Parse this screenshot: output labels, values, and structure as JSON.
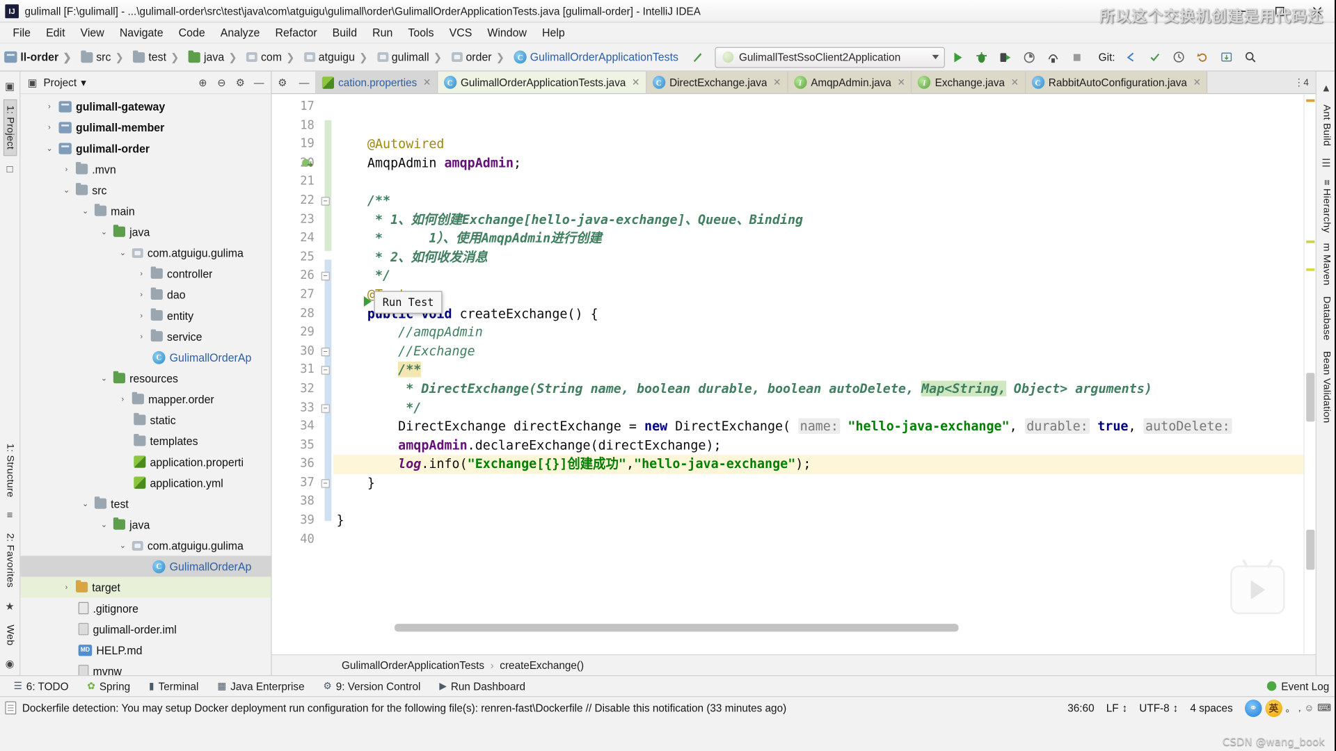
{
  "window": {
    "title": "gulimall [F:\\gulimall] - ...\\gulimall-order\\src\\test\\java\\com\\atguigu\\gulimall\\order\\GulimallOrderApplicationTests.java [gulimall-order] - IntelliJ IDEA",
    "logo_text": "IJ",
    "minimize": "—",
    "maximize": "□",
    "close": "✕"
  },
  "menubar": {
    "items": [
      {
        "label": "File"
      },
      {
        "label": "Edit"
      },
      {
        "label": "View"
      },
      {
        "label": "Navigate"
      },
      {
        "label": "Code"
      },
      {
        "label": "Analyze"
      },
      {
        "label": "Refactor"
      },
      {
        "label": "Build"
      },
      {
        "label": "Run"
      },
      {
        "label": "Tools"
      },
      {
        "label": "VCS"
      },
      {
        "label": "Window"
      },
      {
        "label": "Help"
      }
    ]
  },
  "navbar": {
    "crumbs": [
      {
        "label": "ll-order",
        "icon": "module-icon",
        "bold": true
      },
      {
        "label": "src",
        "icon": "folder-icon"
      },
      {
        "label": "test",
        "icon": "folder-icon"
      },
      {
        "label": "java",
        "icon": "folder-green-icon"
      },
      {
        "label": "com",
        "icon": "package-icon"
      },
      {
        "label": "atguigu",
        "icon": "package-icon"
      },
      {
        "label": "gulimall",
        "icon": "package-icon"
      },
      {
        "label": "order",
        "icon": "package-icon"
      },
      {
        "label": "GulimallOrderApplicationTests",
        "icon": "class-icon",
        "active": true
      }
    ],
    "run_config": {
      "label": "GulimallTestSsoClient2Application",
      "icon": "spring-boot-icon"
    },
    "buttons": [
      {
        "name": "run-button",
        "glyph": "▶"
      },
      {
        "name": "debug-button",
        "glyph": "🐞"
      },
      {
        "name": "run-with-coverage-button",
        "glyph": "▶"
      },
      {
        "name": "profile-button",
        "glyph": "◔"
      },
      {
        "name": "attach-button",
        "glyph": "☰"
      },
      {
        "name": "stop-button",
        "glyph": "■"
      }
    ],
    "git_label": "Git:",
    "git_buttons": [
      {
        "name": "git-update-button",
        "glyph": "↙"
      },
      {
        "name": "git-commit-button",
        "glyph": "✔"
      },
      {
        "name": "git-history-button",
        "glyph": "◴"
      },
      {
        "name": "git-rollback-button",
        "glyph": "↺"
      }
    ],
    "right_buttons": [
      {
        "name": "search-everywhere-icon",
        "glyph": "🔍"
      },
      {
        "name": "settings-icon",
        "glyph": "⚙"
      }
    ]
  },
  "left_rail": {
    "items": [
      {
        "label": "1: Project",
        "selected": true
      },
      {
        "label": "1: Structure"
      },
      {
        "label": "2: Favorites"
      },
      {
        "label": "Web"
      }
    ]
  },
  "right_rail": {
    "items": [
      {
        "label": "Ant Build"
      },
      {
        "label": "≡ Hierarchy"
      },
      {
        "label": "m Maven"
      },
      {
        "label": "Database"
      },
      {
        "label": "Bean Validation"
      }
    ]
  },
  "project_panel": {
    "title": "Project",
    "dropdown_caret": "▾",
    "toolbar_icons": [
      {
        "name": "expand-all-icon",
        "glyph": "⊕"
      },
      {
        "name": "collapse-all-icon",
        "glyph": "⊖"
      },
      {
        "name": "settings-icon",
        "glyph": "⚙"
      },
      {
        "name": "hide-icon",
        "glyph": "—"
      }
    ],
    "tree": [
      {
        "label": "gulimall-gateway",
        "depth": 1,
        "arrow": "›",
        "icon": "module-icon",
        "bold": true
      },
      {
        "label": "gulimall-member",
        "depth": 1,
        "arrow": "›",
        "icon": "module-icon",
        "bold": true
      },
      {
        "label": "gulimall-order",
        "depth": 1,
        "arrow": "⌄",
        "icon": "module-icon",
        "bold": true
      },
      {
        "label": ".mvn",
        "depth": 2,
        "arrow": "›",
        "icon": "folder-icon"
      },
      {
        "label": "src",
        "depth": 2,
        "arrow": "⌄",
        "icon": "folder-icon"
      },
      {
        "label": "main",
        "depth": 3,
        "arrow": "⌄",
        "icon": "folder-icon"
      },
      {
        "label": "java",
        "depth": 4,
        "arrow": "⌄",
        "icon": "folder-green-icon"
      },
      {
        "label": "com.atguigu.gulima",
        "depth": 5,
        "arrow": "⌄",
        "icon": "package-icon"
      },
      {
        "label": "controller",
        "depth": 6,
        "arrow": "›",
        "icon": "folder-icon"
      },
      {
        "label": "dao",
        "depth": 6,
        "arrow": "›",
        "icon": "folder-icon"
      },
      {
        "label": "entity",
        "depth": 6,
        "arrow": "›",
        "icon": "folder-icon"
      },
      {
        "label": "service",
        "depth": 6,
        "arrow": "›",
        "icon": "folder-icon"
      },
      {
        "label": "GulimallOrderAp",
        "depth": 6,
        "arrow": "",
        "icon": "class-icon",
        "blue": true
      },
      {
        "label": "resources",
        "depth": 4,
        "arrow": "⌄",
        "icon": "folder-green-icon"
      },
      {
        "label": "mapper.order",
        "depth": 5,
        "arrow": "›",
        "icon": "folder-icon"
      },
      {
        "label": "static",
        "depth": 5,
        "arrow": "",
        "icon": "folder-icon"
      },
      {
        "label": "templates",
        "depth": 5,
        "arrow": "",
        "icon": "folder-icon"
      },
      {
        "label": "application.properti",
        "depth": 5,
        "arrow": "",
        "icon": "properties-icon"
      },
      {
        "label": "application.yml",
        "depth": 5,
        "arrow": "",
        "icon": "properties-icon"
      },
      {
        "label": "test",
        "depth": 3,
        "arrow": "⌄",
        "icon": "folder-icon"
      },
      {
        "label": "java",
        "depth": 4,
        "arrow": "⌄",
        "icon": "folder-green-icon"
      },
      {
        "label": "com.atguigu.gulima",
        "depth": 5,
        "arrow": "⌄",
        "icon": "package-icon"
      },
      {
        "label": "GulimallOrderAp",
        "depth": 6,
        "arrow": "",
        "icon": "class-icon",
        "blue": true,
        "selected": true
      },
      {
        "label": "target",
        "depth": 2,
        "arrow": "›",
        "icon": "folder-orange-icon",
        "highlight": true
      },
      {
        "label": ".gitignore",
        "depth": 3,
        "arrow": "",
        "icon": "gitignore-icon"
      },
      {
        "label": "gulimall-order.iml",
        "depth": 3,
        "arrow": "",
        "icon": "file-icon"
      },
      {
        "label": "HELP.md",
        "depth": 3,
        "arrow": "",
        "icon": "markdown-icon"
      },
      {
        "label": "mvnw",
        "depth": 3,
        "arrow": "",
        "icon": "file-icon"
      }
    ]
  },
  "editor": {
    "tabs": [
      {
        "label": "cation.properties",
        "icon": "properties-icon",
        "state": "normal",
        "kind": "prop"
      },
      {
        "label": "GulimallOrderApplicationTests.java",
        "icon": "class-icon",
        "state": "active",
        "kind": "class"
      },
      {
        "label": "DirectExchange.java",
        "icon": "class-icon",
        "state": "tan",
        "kind": "class"
      },
      {
        "label": "AmqpAdmin.java",
        "icon": "interface-icon",
        "state": "tan",
        "kind": "iface"
      },
      {
        "label": "Exchange.java",
        "icon": "interface-icon",
        "state": "tan",
        "kind": "iface"
      },
      {
        "label": "RabbitAutoConfiguration.java",
        "icon": "class-icon",
        "state": "tan",
        "kind": "class"
      }
    ],
    "tab_overflow": "⋮4",
    "gutter_icons": [
      {
        "name": "settings-gear-icon",
        "glyph": "⚙"
      },
      {
        "name": "hide-editor-icon",
        "glyph": "—"
      }
    ],
    "first_line_number": 17,
    "last_line_number": 40,
    "lines": [
      {
        "n": 17,
        "text": ""
      },
      {
        "n": 18,
        "text": ""
      },
      {
        "n": 19,
        "text": "    @Autowired"
      },
      {
        "n": 20,
        "text": "    AmqpAdmin amqpAdmin;"
      },
      {
        "n": 21,
        "text": ""
      },
      {
        "n": 22,
        "text": "    /**"
      },
      {
        "n": 23,
        "text": "     * 1、如何创建Exchange[hello-java-exchange]、Queue、Binding"
      },
      {
        "n": 24,
        "text": "     *      1）、使用AmqpAdmin进行创建"
      },
      {
        "n": 25,
        "text": "     * 2、如何收发消息"
      },
      {
        "n": 26,
        "text": "     */"
      },
      {
        "n": 27,
        "text": "    @Test"
      },
      {
        "n": 28,
        "text": "    public void createExchange() {"
      },
      {
        "n": 29,
        "text": "        //amqpAdmin"
      },
      {
        "n": 30,
        "text": "        //Exchange"
      },
      {
        "n": 31,
        "text": "        /**"
      },
      {
        "n": 32,
        "text": "         * DirectExchange(String name, boolean durable, boolean autoDelete, Map<String, Object> arguments)"
      },
      {
        "n": 33,
        "text": "         */"
      },
      {
        "n": 34,
        "text": "        DirectExchange directExchange = new DirectExchange( name: \"hello-java-exchange\", durable: true, autoDelete:"
      },
      {
        "n": 35,
        "text": "        amqpAdmin.declareExchange(directExchange);"
      },
      {
        "n": 36,
        "text": "        log.info(\"Exchange[{}]创建成功\",\"hello-java-exchange\");"
      },
      {
        "n": 37,
        "text": "    }"
      },
      {
        "n": 38,
        "text": ""
      },
      {
        "n": 39,
        "text": "}"
      },
      {
        "n": 40,
        "text": ""
      }
    ],
    "tooltip": {
      "label": "Run Test"
    },
    "breadcrumb": {
      "class": "GulimallOrderApplicationTests",
      "separator": "›",
      "method": "createExchange()"
    }
  },
  "bottom_toolwindows": {
    "items": [
      {
        "label": "6: TODO",
        "icon": "todo-icon"
      },
      {
        "label": "Spring",
        "icon": "spring-icon"
      },
      {
        "label": "Terminal",
        "icon": "terminal-icon"
      },
      {
        "label": "Java Enterprise",
        "icon": "java-enterprise-icon"
      },
      {
        "label": "9: Version Control",
        "icon": "version-control-icon"
      },
      {
        "label": "Run Dashboard",
        "icon": "run-dashboard-icon"
      }
    ],
    "event_log": "Event Log"
  },
  "statusbar": {
    "message": "Dockerfile detection: You may setup Docker deployment run configuration for the following file(s): renren-fast\\Dockerfile // Disable this notification (33 minutes ago)",
    "caret_position": "36:60",
    "line_separator": "LF",
    "line_separator_caret": "↕",
    "encoding": "UTF-8",
    "encoding_caret": "↕",
    "indent": "4 spaces",
    "ime_cn": "英",
    "ime_symbols": [
      "。",
      ",",
      "☺",
      "⌨"
    ]
  },
  "overlays": {
    "top_watermark": "所以这个交换机创建是用代码还",
    "bottom_watermark": "CSDN @wang_book"
  },
  "colors": {
    "accent_blue": "#2d5fa8",
    "keyword": "#000080",
    "string": "#008000",
    "comment": "#3f7f5f",
    "annotation": "#9e880d",
    "field": "#660e7a",
    "highlight_line": "#fdf6d8",
    "chrome": "#f2f2f2"
  }
}
